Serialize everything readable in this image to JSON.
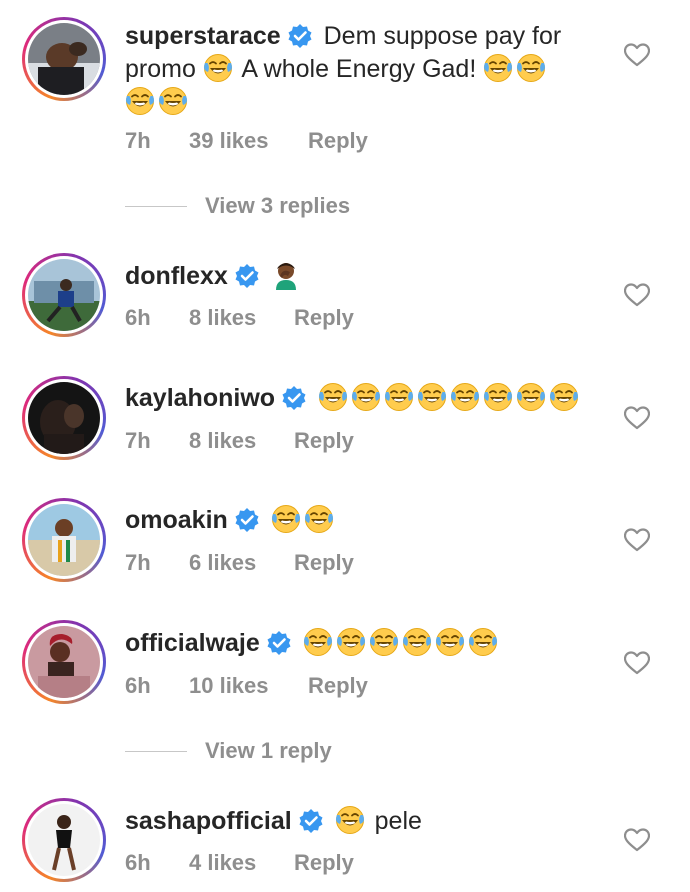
{
  "comments": [
    {
      "username": "superstarace",
      "text_parts": [
        "Dem suppose pay for",
        "promo",
        "A whole Energy Gad!"
      ],
      "time": "7h",
      "likes": "39 likes",
      "reply": "Reply"
    },
    {
      "username": "donflexx",
      "time": "6h",
      "likes": "8 likes",
      "reply": "Reply"
    },
    {
      "username": "kaylahoniwo",
      "time": "7h",
      "likes": "8 likes",
      "reply": "Reply"
    },
    {
      "username": "omoakin",
      "time": "7h",
      "likes": "6 likes",
      "reply": "Reply"
    },
    {
      "username": "officialwaje",
      "time": "6h",
      "likes": "10 likes",
      "reply": "Reply"
    },
    {
      "username": "sashapofficial",
      "text": "pele",
      "time": "6h",
      "likes": "4 likes",
      "reply": "Reply"
    }
  ],
  "view_replies": [
    "View 3 replies",
    "View 1 reply"
  ],
  "icons": {
    "verified": "verified-badge-icon",
    "heart": "heart-outline-icon",
    "laugh": "face-with-tears-of-joy-emoji",
    "facepalm": "person-facepalming-emoji"
  },
  "colors": {
    "verified_blue": "#3897f0",
    "meta_gray": "#8e8e8e",
    "text": "#262626"
  }
}
